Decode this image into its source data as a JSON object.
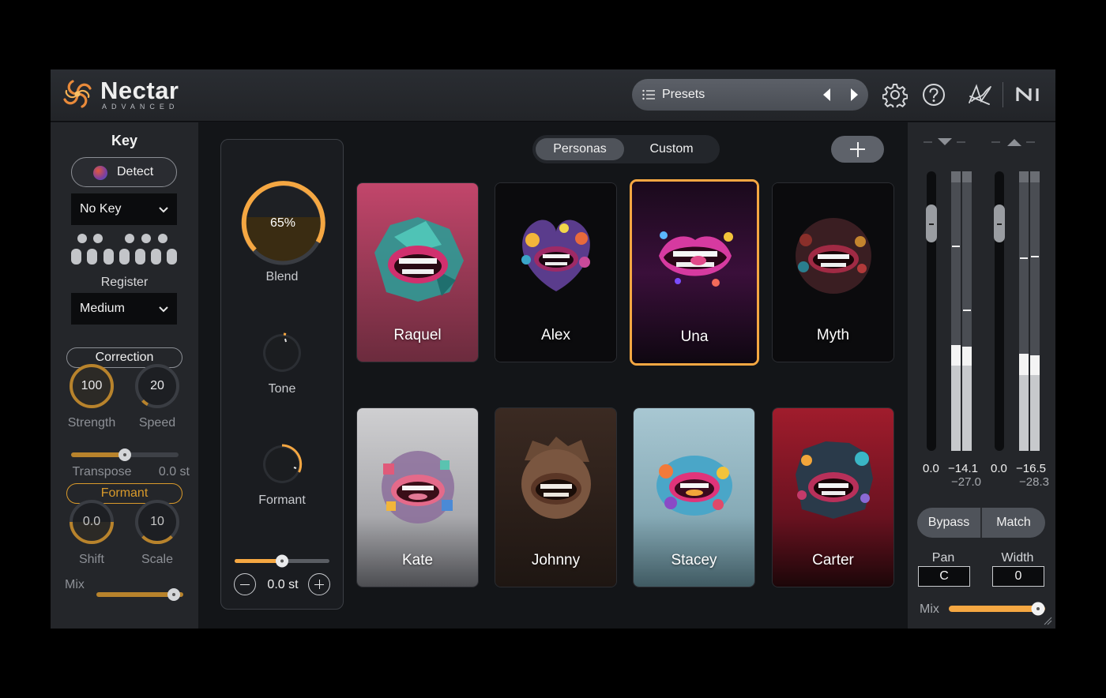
{
  "header": {
    "brand": "Nectar",
    "brand_sub": "ADVANCED",
    "presets_label": "Presets",
    "icons": [
      "list-icon",
      "triangle-left-icon",
      "triangle-right-icon",
      "gear-icon",
      "help-icon",
      "signal-chain-icon",
      "ni-logo-icon"
    ]
  },
  "key_panel": {
    "title": "Key",
    "detect_label": "Detect",
    "key_value": "No Key",
    "register_label": "Register",
    "register_value": "Medium",
    "correction_label": "Correction",
    "strength_value": "100",
    "strength_label": "Strength",
    "speed_value": "20",
    "speed_label": "Speed",
    "transpose_label": "Transpose",
    "transpose_value": "0.0 st",
    "formant_label": "Formant",
    "shift_value": "0.0",
    "shift_label": "Shift",
    "scale_value": "10",
    "scale_label": "Scale",
    "mix_label": "Mix"
  },
  "blend_panel": {
    "blend_value": "65%",
    "blend_label": "Blend",
    "tone_label": "Tone",
    "formant_label": "Formant",
    "pitch_value": "0.0 st"
  },
  "tabs": [
    "Personas",
    "Custom"
  ],
  "active_tab": "Personas",
  "personas": [
    {
      "name": "Raquel",
      "selected": false
    },
    {
      "name": "Alex",
      "selected": false
    },
    {
      "name": "Una",
      "selected": true
    },
    {
      "name": "Myth",
      "selected": false
    },
    {
      "name": "Kate",
      "selected": false
    },
    {
      "name": "Johnny",
      "selected": false
    },
    {
      "name": "Stacey",
      "selected": false
    },
    {
      "name": "Carter",
      "selected": false
    }
  ],
  "output_panel": {
    "in_gain": "0.0",
    "in_peak": "−14.1",
    "in_rms": "−27.0",
    "out_gain": "0.0",
    "out_peak": "−16.5",
    "out_rms": "−28.3",
    "bypass_label": "Bypass",
    "match_label": "Match",
    "pan_label": "Pan",
    "pan_value": "C",
    "width_label": "Width",
    "width_value": "0",
    "mix_label": "Mix"
  },
  "colors": {
    "accent": "#f5a742",
    "gold": "#d99a2b",
    "panel": "#24262a",
    "background": "#131518"
  }
}
